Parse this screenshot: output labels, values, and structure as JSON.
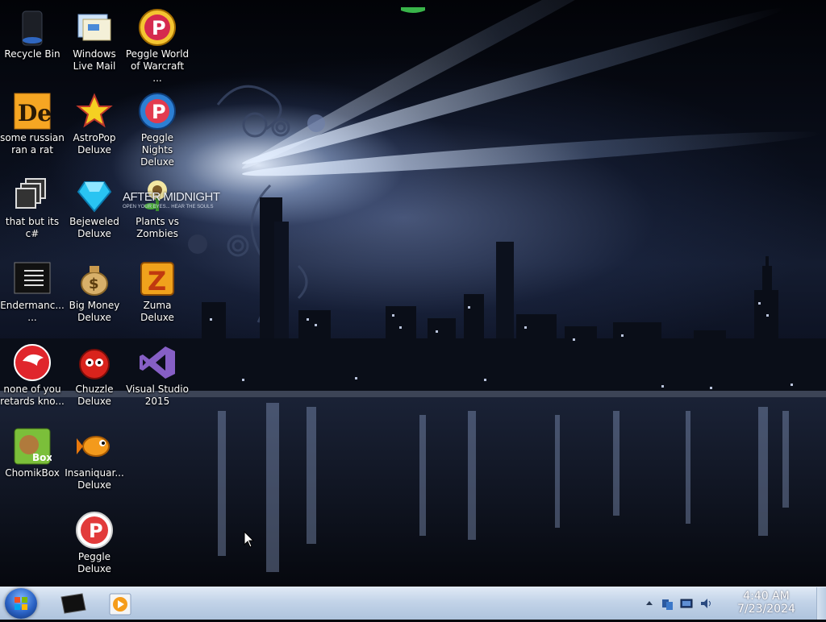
{
  "desktop": {
    "icons": [
      {
        "label": "Recycle Bin",
        "icon": "recycle-bin-icon"
      },
      {
        "label": "Windows Live Mail",
        "icon": "mail-icon"
      },
      {
        "label": "Peggle World of Warcraft ...",
        "icon": "peggle-icon"
      },
      {
        "label": "some russian ran a rat",
        "icon": "de-app-icon"
      },
      {
        "label": "AstroPop Deluxe",
        "icon": "astropop-icon"
      },
      {
        "label": "Peggle Nights Deluxe",
        "icon": "peggle-nights-icon"
      },
      {
        "label": "that but its c#",
        "icon": "copy-windows-icon"
      },
      {
        "label": "Bejeweled Deluxe",
        "icon": "gem-icon"
      },
      {
        "label": "Plants vs Zombies",
        "icon": "plant-icon"
      },
      {
        "label": "Endermanc... ...",
        "icon": "terminal-icon"
      },
      {
        "label": "Big Money Deluxe",
        "icon": "money-bag-icon"
      },
      {
        "label": "Zuma Deluxe",
        "icon": "zuma-icon"
      },
      {
        "label": "none of you retards kno...",
        "icon": "parrot-icon"
      },
      {
        "label": "Chuzzle Deluxe",
        "icon": "chuzzle-icon"
      },
      {
        "label": "Visual Studio 2015",
        "icon": "visual-studio-icon"
      },
      {
        "label": "ChomikBox",
        "icon": "hamster-icon"
      },
      {
        "label": "Insaniquar... Deluxe",
        "icon": "goldfish-icon"
      },
      {
        "label": "Peggle Deluxe",
        "icon": "peggle-deluxe-icon"
      }
    ],
    "wallpaper_overlay_text": "AFTER MIDNIGHT",
    "wallpaper_overlay_subtext": "OPEN YOUR EYES... HEAR THE SOULS"
  },
  "taskbar": {
    "start": "start-orb-icon",
    "pinned": [
      "terminal-window-icon",
      "media-player-icon"
    ],
    "tray_icons": [
      "show-hidden-icons-arrow",
      "network-icon",
      "display-icon",
      "volume-icon"
    ],
    "time": "4:40 AM",
    "date": "7/23/2024"
  },
  "colors": {
    "taskbar": "#c2d3e8",
    "clock_text": "#ffffff",
    "label_text": "#ffffff"
  }
}
